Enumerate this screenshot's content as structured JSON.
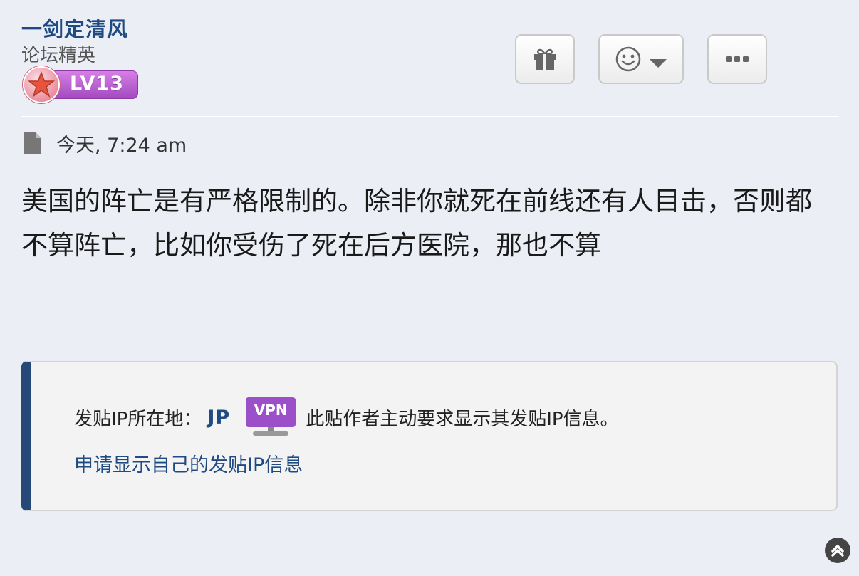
{
  "user": {
    "name": "一剑定清风",
    "title": "论坛精英",
    "level": "LV13"
  },
  "actions": {
    "gift_icon": "gift-icon",
    "reaction_icon": "smiley-icon",
    "more_icon": "ellipsis-icon"
  },
  "post": {
    "timestamp": "今天, 7:24 am",
    "body": "美国的阵亡是有严格限制的。除非你就死在前线还有人目击，否则都不算阵亡，比如你受伤了死在后方医院，那也不算"
  },
  "ip_info": {
    "label": "发贴IP所在地：",
    "country": "JP",
    "vpn_label": "VPN",
    "note": "此贴作者主动要求显示其发贴IP信息。",
    "request_link": "申请显示自己的发贴IP信息"
  },
  "colors": {
    "accent": "#1f4b82",
    "ip_box_border": "#26497a",
    "vpn_purple": "#9b4fc9",
    "background": "#ebeff5"
  }
}
